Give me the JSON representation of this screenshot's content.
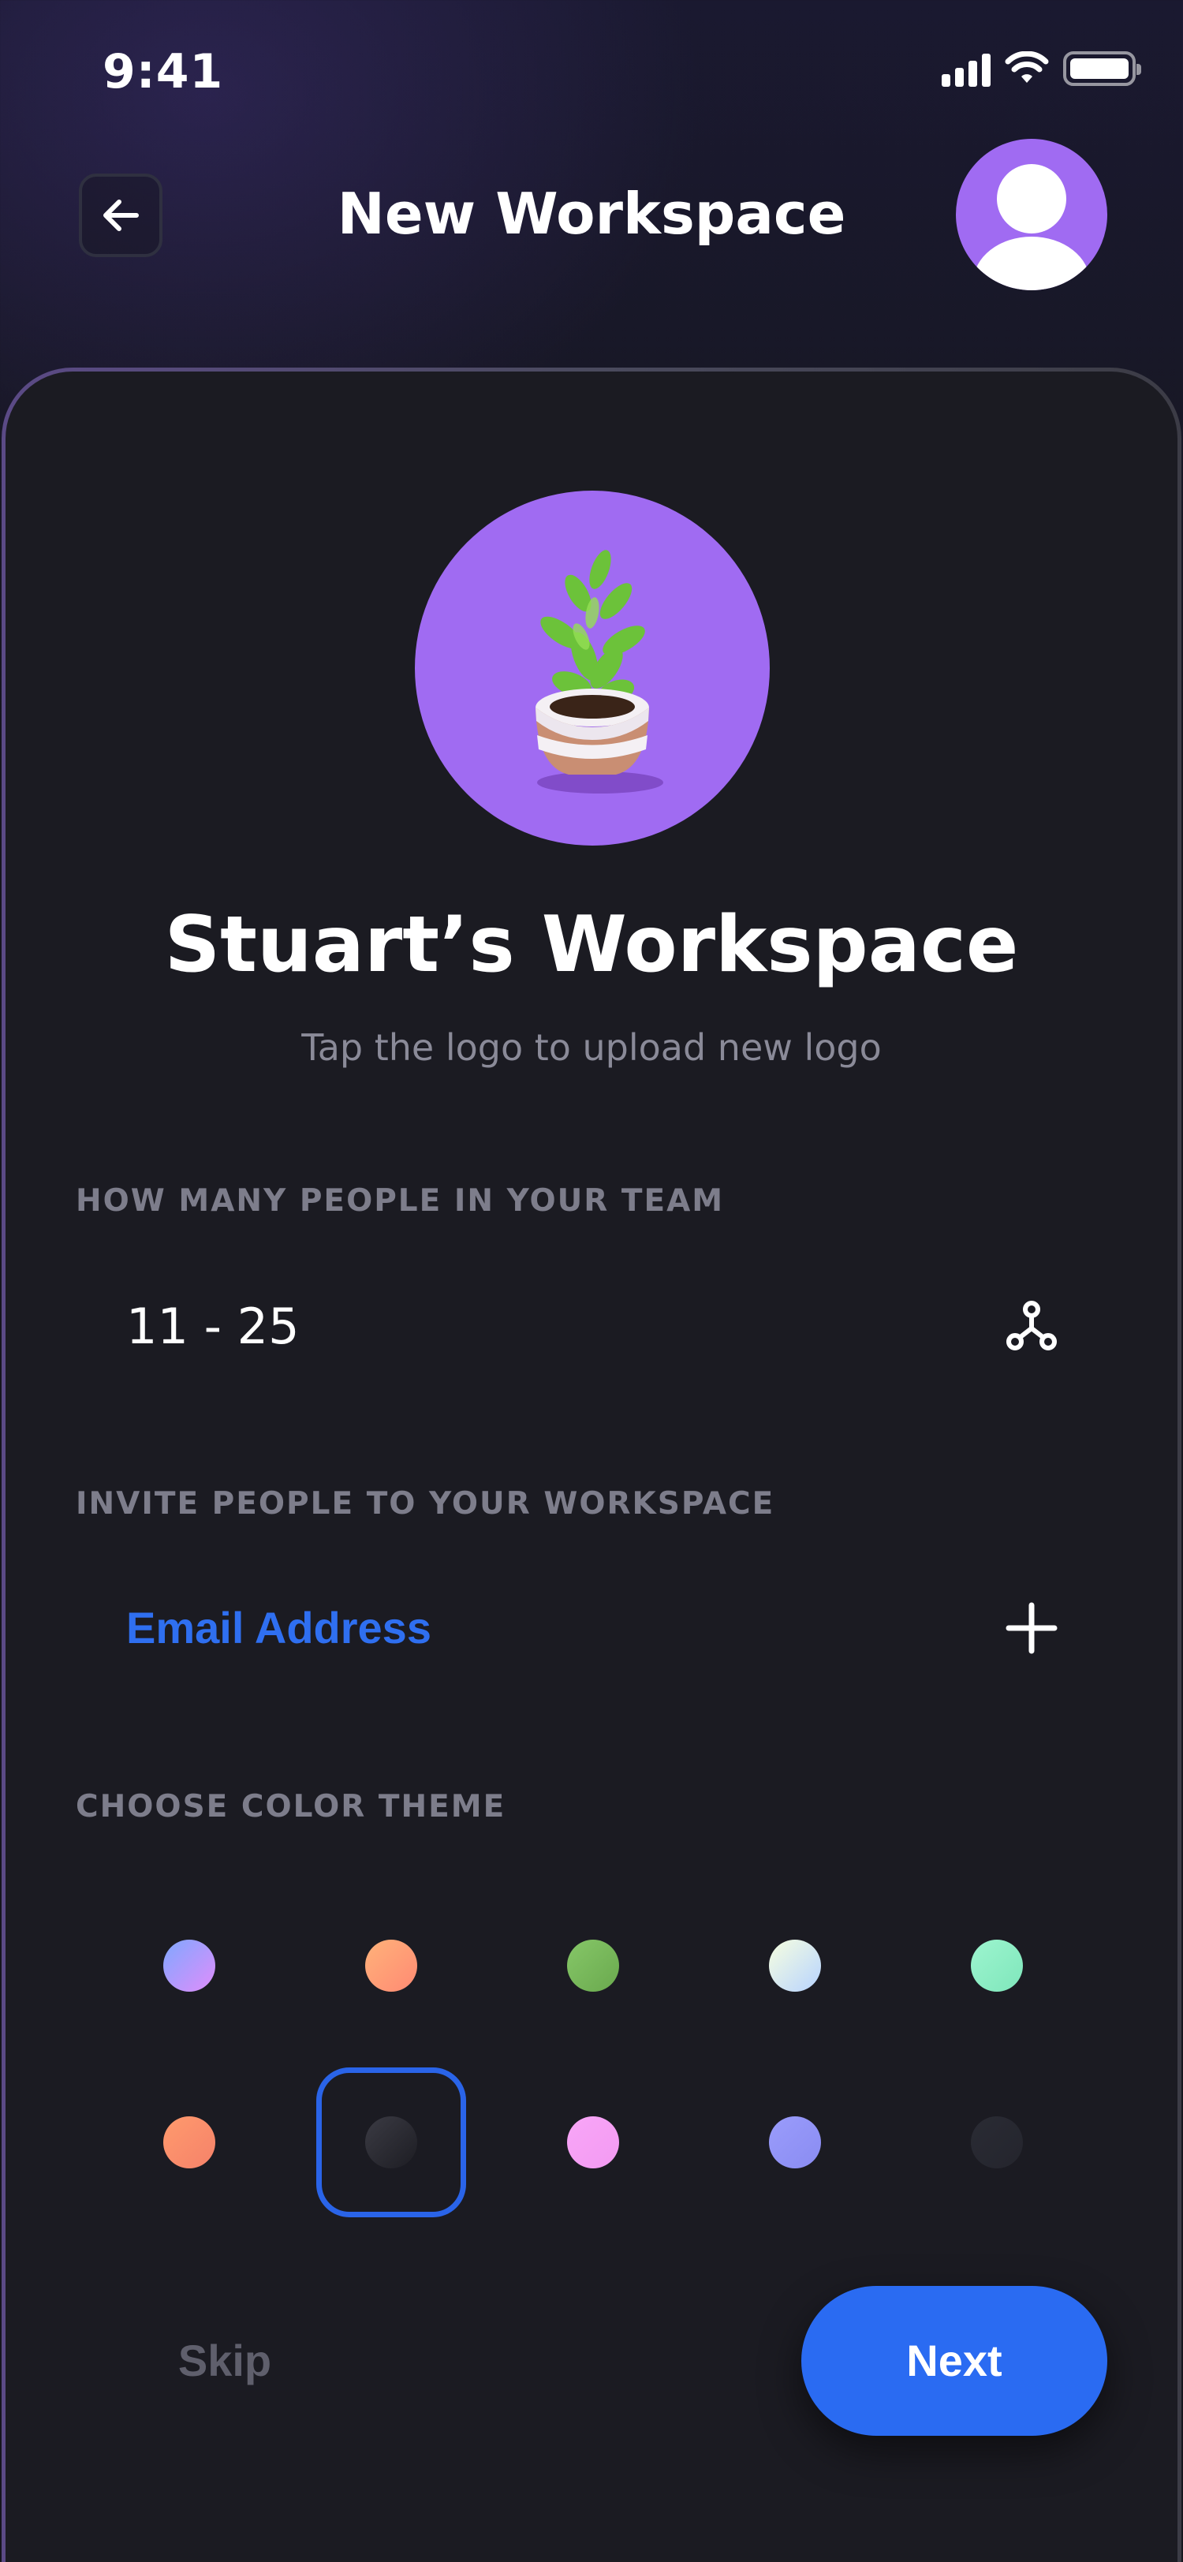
{
  "status_bar": {
    "time": "9:41"
  },
  "header": {
    "title": "New Workspace"
  },
  "workspace": {
    "name": "Stuart’s Workspace",
    "upload_hint": "Tap the logo to upload new logo"
  },
  "team_size": {
    "label": "HOW MANY PEOPLE IN YOUR TEAM",
    "value": "11 - 25",
    "icon": "network-icon"
  },
  "invite": {
    "label": "INVITE PEOPLE TO YOUR WORKSPACE",
    "placeholder": "Email Address",
    "icon": "plus-icon"
  },
  "theme": {
    "label": "CHOOSE COLOR THEME",
    "selected_index": 6,
    "swatches": [
      {
        "colors": [
          "#7fa8ff",
          "#e08dfb"
        ]
      },
      {
        "colors": [
          "#ffb27a",
          "#ff8a73"
        ]
      },
      {
        "colors": [
          "#86c768",
          "#6aa94e"
        ]
      },
      {
        "colors": [
          "#f7ffe0",
          "#b7d3ff"
        ]
      },
      {
        "colors": [
          "#9df5cf",
          "#7fe6bb"
        ]
      },
      {
        "colors": [
          "#ff9a6d",
          "#f5826a"
        ]
      },
      {
        "colors": [
          "#3b3b44",
          "#1d1d23"
        ]
      },
      {
        "colors": [
          "#f8a6f7",
          "#f39af2"
        ]
      },
      {
        "colors": [
          "#9a9cfb",
          "#8a8cf2"
        ]
      },
      {
        "colors": [
          "#2a2b34",
          "#24252d"
        ]
      }
    ]
  },
  "actions": {
    "skip": "Skip",
    "next": "Next"
  },
  "colors": {
    "accent": "#2a6bf2",
    "logo_bg": "#a06bf2",
    "email_placeholder": "#2f6ff0"
  }
}
